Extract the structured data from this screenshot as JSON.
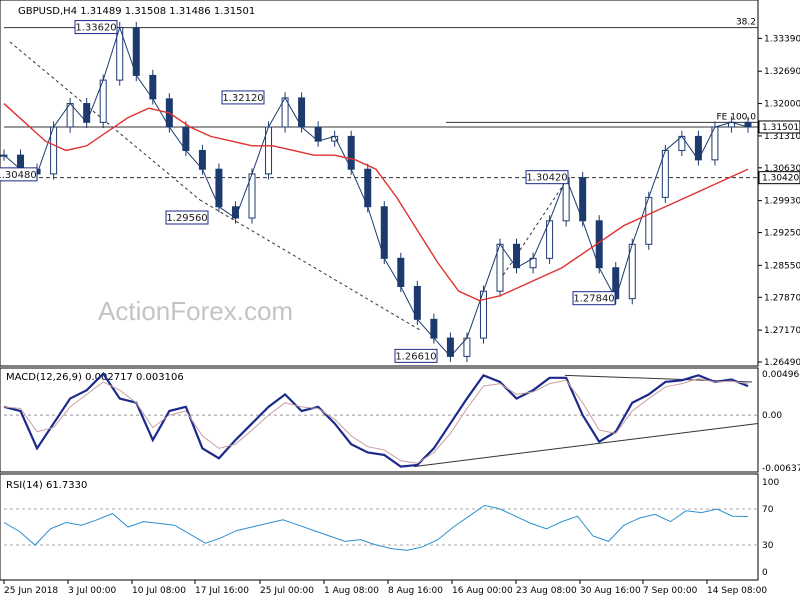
{
  "window": {
    "symbol_line": "GBPUSD,H4  1.31489  1.31508  1.31486  1.31501",
    "watermark": "ActionForex.com"
  },
  "colors": {
    "candle": "#1d3a6e",
    "ma": "#e23030",
    "macd": "#1b2a8c",
    "signal": "#c8a0a0",
    "rsi": "#2a8fcf",
    "label_box": "#1b2a8c"
  },
  "chart_data": [
    {
      "type": "line",
      "title": "GBPUSD,H4",
      "ylim": [
        1.2649,
        1.3408
      ],
      "yticks": [
        1.3339,
        1.3269,
        1.32,
        1.3131,
        1.3063,
        1.2993,
        1.2925,
        1.2855,
        1.2787,
        1.2717,
        1.2649
      ],
      "ytick_labels": [
        "1.33390",
        "1.32690",
        "1.32000",
        "1.31310",
        "1.30630",
        "1.29930",
        "1.29250",
        "1.28550",
        "1.27870",
        "1.27170",
        "1.26490"
      ],
      "price_tags": [
        {
          "label": "1.31501",
          "value": 1.31501,
          "style": "dark"
        },
        {
          "label": "1.30420",
          "value": 1.3042,
          "style": "dark"
        }
      ],
      "horizontal_lines": [
        {
          "value": 1.3362,
          "label": "38.2",
          "style": "solid"
        },
        {
          "value": 1.316,
          "label": "FE 100.0",
          "style": "solid"
        },
        {
          "value": 1.31501,
          "label": "",
          "style": "solid"
        },
        {
          "value": 1.3042,
          "label": "",
          "style": "dashed"
        }
      ],
      "annotations": [
        {
          "text": "1.33620",
          "x": "2018-07-06 04:00",
          "y": 1.3362
        },
        {
          "text": "1.32120",
          "x": "2018-07-25 04:00",
          "y": 1.3212
        },
        {
          "text": "1.29560",
          "x": "2018-07-19 16:00",
          "y": 1.2956
        },
        {
          "text": "1.30480",
          "x": "2018-06-26 04:00",
          "y": 1.3048
        },
        {
          "text": "1.26610",
          "x": "2018-08-15 16:00",
          "y": 1.2661
        },
        {
          "text": "1.30420",
          "x": "2018-08-30 16:00",
          "y": 1.3042
        },
        {
          "text": "1.27840",
          "x": "2018-09-06 00:00",
          "y": 1.2784
        }
      ],
      "x": [
        "25 Jun 2018",
        "3 Jul 00:00",
        "10 Jul 08:00",
        "17 Jul 16:00",
        "25 Jul 00:00",
        "1 Aug 08:00",
        "8 Aug 16:00",
        "16 Aug 00:00",
        "23 Aug 08:00",
        "30 Aug 16:00",
        "7 Sep 00:00",
        "14 Sep 08:00"
      ],
      "series": [
        {
          "values": [
            1.309,
            1.306,
            1.305,
            1.315,
            1.32,
            1.316,
            1.325,
            1.3362,
            1.326,
            1.321,
            1.315,
            1.31,
            1.306,
            1.298,
            1.2956,
            1.305,
            1.315,
            1.3212,
            1.315,
            1.312,
            1.313,
            1.306,
            1.298,
            1.287,
            1.281,
            1.274,
            1.27,
            1.2661,
            1.27,
            1.28,
            1.29,
            1.285,
            1.287,
            1.295,
            1.3042,
            1.295,
            1.285,
            1.2784,
            1.29,
            1.3,
            1.31,
            1.313,
            1.308,
            1.315,
            1.316,
            1.315
          ]
        },
        {
          "values": [
            1.32,
            1.316,
            1.312,
            1.31,
            1.311,
            1.314,
            1.317,
            1.319,
            1.318,
            1.315,
            1.313,
            1.312,
            1.311,
            1.311,
            1.31,
            1.309,
            1.309,
            1.308,
            1.306,
            1.3,
            1.293,
            1.286,
            1.28,
            1.278,
            1.279,
            1.281,
            1.283,
            1.285,
            1.288,
            1.291,
            1.294,
            1.296,
            1.298,
            1.3,
            1.302,
            1.304,
            1.306
          ]
        }
      ]
    },
    {
      "type": "line",
      "title": "MACD(12,26,9) 0.002717 0.003106",
      "ylim": [
        -0.00637,
        0.00496
      ],
      "ytick_labels": [
        "0.004968",
        "0.00",
        "-0.006372"
      ],
      "yticks": [
        0.004968,
        0.0,
        -0.006372
      ],
      "series": [
        {
          "values": [
            0.001,
            0.0005,
            -0.004,
            -0.001,
            0.002,
            0.003,
            0.005,
            0.002,
            0.0015,
            -0.003,
            0.0005,
            0.001,
            -0.004,
            -0.0052,
            -0.003,
            -0.001,
            0.001,
            0.0025,
            0.0005,
            0.001,
            -0.001,
            -0.0035,
            -0.0045,
            -0.0048,
            -0.0062,
            -0.006,
            -0.004,
            -0.001,
            0.002,
            0.0048,
            0.004,
            0.002,
            0.003,
            0.0045,
            0.0045,
            0.0,
            -0.0032,
            -0.002,
            0.0015,
            0.0025,
            0.004,
            0.0042,
            0.0048,
            0.004,
            0.0043,
            0.0035
          ]
        },
        {
          "values": [
            0.001,
            0.0008,
            -0.002,
            -0.0015,
            0.001,
            0.0025,
            0.004,
            0.003,
            0.0015,
            -0.0015,
            0.0,
            0.0005,
            -0.0025,
            -0.004,
            -0.0035,
            -0.0018,
            0.0,
            0.0015,
            0.001,
            0.0008,
            -0.0005,
            -0.0025,
            -0.0038,
            -0.0042,
            -0.0055,
            -0.0058,
            -0.0045,
            -0.0022,
            0.0008,
            0.0035,
            0.0038,
            0.0025,
            0.0028,
            0.0038,
            0.0042,
            0.0015,
            -0.0018,
            -0.0022,
            0.0005,
            0.002,
            0.0034,
            0.0038,
            0.0044,
            0.004,
            0.0041,
            0.0038
          ]
        }
      ]
    },
    {
      "type": "line",
      "title": "RSI(14) 61.7330",
      "ylim": [
        0,
        100
      ],
      "yticks": [
        100,
        70,
        30,
        0
      ],
      "ytick_labels": [
        "100",
        "70",
        "30",
        "0"
      ],
      "series": [
        {
          "values": [
            55,
            45,
            30,
            48,
            55,
            52,
            58,
            65,
            50,
            56,
            54,
            52,
            42,
            32,
            38,
            46,
            50,
            54,
            58,
            52,
            46,
            40,
            34,
            36,
            30,
            26,
            24,
            28,
            36,
            50,
            62,
            74,
            70,
            62,
            54,
            48,
            56,
            62,
            40,
            34,
            52,
            60,
            64,
            56,
            68,
            66,
            70,
            62,
            61.7
          ]
        }
      ]
    }
  ],
  "axis": {
    "x_labels": [
      "25 Jun 2018",
      "3 Jul 00:00",
      "10 Jul 08:00",
      "17 Jul 16:00",
      "25 Jul 00:00",
      "1 Aug 08:00",
      "8 Aug 16:00",
      "16 Aug 00:00",
      "23 Aug 08:00",
      "30 Aug 16:00",
      "7 Sep 00:00",
      "14 Sep 08:00"
    ]
  }
}
